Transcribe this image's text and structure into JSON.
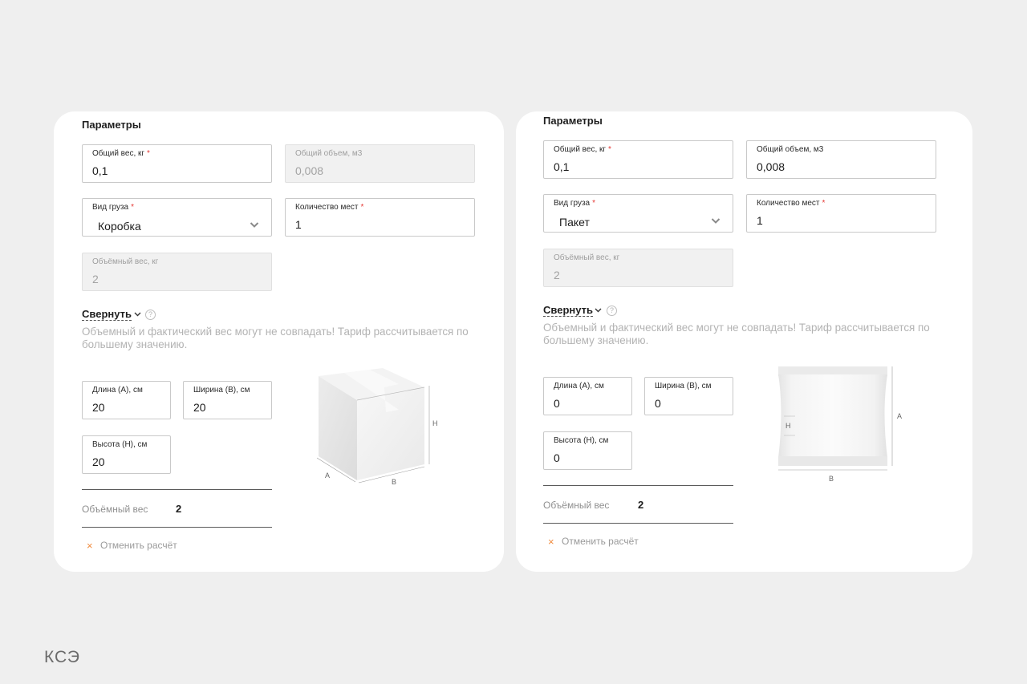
{
  "brand": {
    "logo_text": "КСЭ"
  },
  "left": {
    "title": "Параметры",
    "total_weight": {
      "label": "Общий вес, кг",
      "required": "*",
      "value": "0,1"
    },
    "total_volume": {
      "label": "Общий объем, м3",
      "value": "0,008"
    },
    "cargo_type": {
      "label": "Вид груза",
      "required": "*",
      "value": "Коробка"
    },
    "places": {
      "label": "Количество мест",
      "required": "*",
      "value": "1"
    },
    "volume_weight_field": {
      "label": "Объёмный вес, кг",
      "value": "2"
    },
    "collapse_label": "Свернуть",
    "help": "?",
    "note": "Объемный и фактический вес могут не совпадать! Тариф рассчитывается по большему значению.",
    "length": {
      "label": "Длина (А), см",
      "value": "20"
    },
    "width": {
      "label": "Ширина (В), см",
      "value": "20"
    },
    "height": {
      "label": "Высота (Н), см",
      "value": "20"
    },
    "volume_weight_label": "Объёмный вес",
    "volume_weight_value": "2",
    "cancel_icon": "×",
    "cancel_label": "Отменить расчёт",
    "illustration": {
      "icon": "box-icon",
      "dim_h": "H",
      "dim_a": "A",
      "dim_b": "B"
    }
  },
  "right": {
    "title": "Параметры",
    "total_weight": {
      "label": "Общий вес, кг",
      "required": "*",
      "value": "0,1"
    },
    "total_volume": {
      "label": "Общий объем, м3",
      "value": "0,008"
    },
    "cargo_type": {
      "label": "Вид груза",
      "required": "*",
      "value": "Пакет"
    },
    "places": {
      "label": "Количество мест",
      "required": "*",
      "value": "1"
    },
    "volume_weight_field": {
      "label": "Объёмный вес, кг",
      "value": "2"
    },
    "collapse_label": "Свернуть",
    "help": "?",
    "note": "Объемный и фактический вес могут не совпадать! Тариф рассчитывается по большему значению.",
    "length": {
      "label": "Длина (А), см",
      "value": "0"
    },
    "width": {
      "label": "Ширина (В), см",
      "value": "0"
    },
    "height": {
      "label": "Высота (Н), см",
      "value": "0"
    },
    "volume_weight_label": "Объёмный вес",
    "volume_weight_value": "2",
    "cancel_icon": "×",
    "cancel_label": "Отменить расчёт",
    "illustration": {
      "icon": "package-icon",
      "dim_h": "H",
      "dim_a": "A",
      "dim_b": "B"
    }
  }
}
